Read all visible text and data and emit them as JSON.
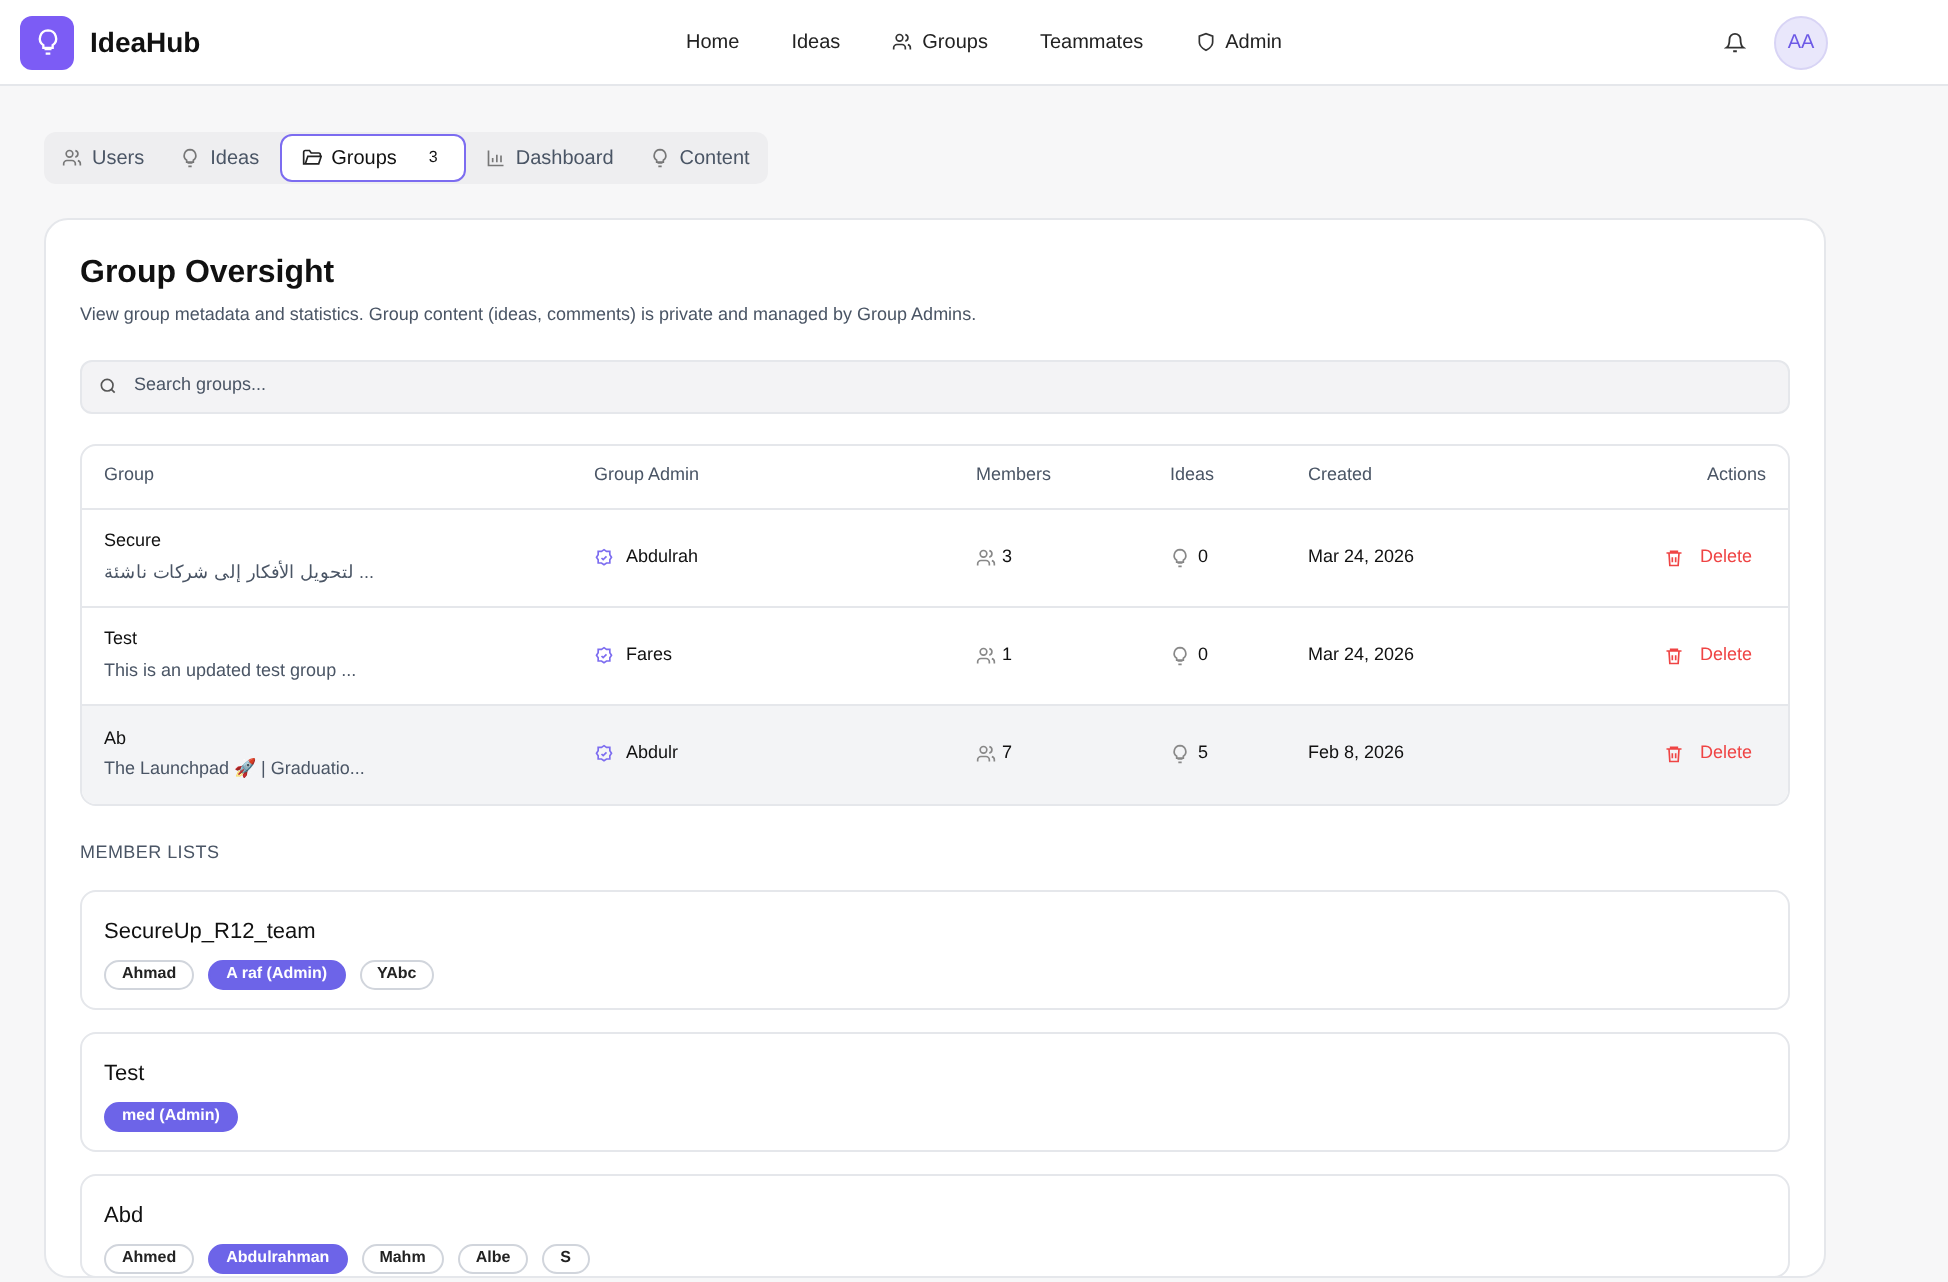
{
  "app": {
    "name": "IdeaHub"
  },
  "nav": [
    {
      "label": "Home"
    },
    {
      "label": "Ideas"
    },
    {
      "label": "Groups"
    },
    {
      "label": "Teammates"
    },
    {
      "label": "Admin"
    }
  ],
  "avatar": "AA",
  "tabs": [
    {
      "label": "Users",
      "selected": false
    },
    {
      "label": "Ideas",
      "selected": false
    },
    {
      "label": "Groups",
      "selected": true,
      "count": "3"
    },
    {
      "label": "Dashboard",
      "selected": false
    },
    {
      "label": "Content",
      "selected": false
    }
  ],
  "panel": {
    "title": "Group Oversight",
    "subtitle": "View group metadata and statistics. Group content (ideas, comments) is private and managed by Group Admins.",
    "search": {
      "placeholder": "Search groups..."
    }
  },
  "table": {
    "columns": [
      "Group",
      "Group Admin",
      "Members",
      "Ideas",
      "Created",
      "Actions"
    ],
    "rows": [
      {
        "name": "Secure",
        "description": "لتحويل الأفكار إلى شركات ناشئة ...",
        "admin": "Abdulrah",
        "members": "3",
        "ideas": "0",
        "created": "Mar 24, 2026",
        "action": "Delete",
        "highlighted": false
      },
      {
        "name": "Test",
        "description": "This is an updated test group ...",
        "admin": "Fares",
        "members": "1",
        "ideas": "0",
        "created": "Mar 24, 2026",
        "action": "Delete",
        "highlighted": false
      },
      {
        "name": "Ab",
        "description": "The Launchpad 🚀 | Graduatio...",
        "admin": "Abdulr",
        "members": "7",
        "ideas": "5",
        "created": "Feb 8, 2026",
        "action": "Delete",
        "highlighted": true
      }
    ]
  },
  "member_lists": {
    "heading": "MEMBER LISTS",
    "groups": [
      {
        "name": "SecureUp_R12_team",
        "members": [
          {
            "name": "Ahmad",
            "admin": false
          },
          {
            "name": "A raf (Admin)",
            "admin": true
          },
          {
            "name": "YAbc",
            "admin": false
          }
        ]
      },
      {
        "name": "Test",
        "members": [
          {
            "name": "med (Admin)",
            "admin": true
          }
        ]
      },
      {
        "name": "Abd",
        "members": [
          {
            "name": "Ahmed",
            "admin": false
          },
          {
            "name": "Abdulrahman",
            "admin": true
          },
          {
            "name": "Mahm",
            "admin": false
          },
          {
            "name": "Albe",
            "admin": false
          },
          {
            "name": "S",
            "admin": false
          }
        ]
      }
    ]
  }
}
